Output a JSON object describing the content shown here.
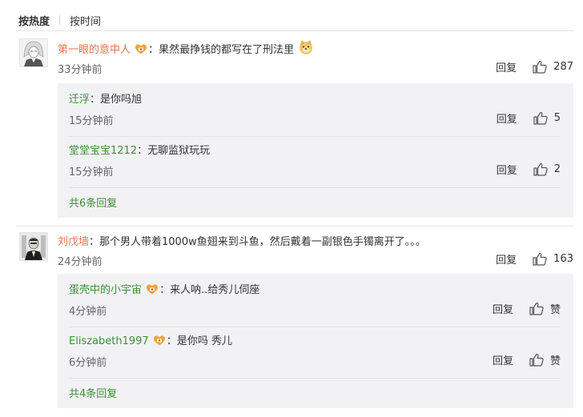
{
  "sort": {
    "active": "按热度",
    "other": "按时间"
  },
  "comments": [
    {
      "username": "第一眼的意中人",
      "text": "：果然最挣钱的都写在了刑法里",
      "time": "33分钟前",
      "reply_label": "回复",
      "likes": "287",
      "replies": [
        {
          "username": "迁浮",
          "text": "：是你吗旭",
          "time": "15分钟前",
          "reply_label": "回复",
          "likes": "5"
        },
        {
          "username": "堂堂宝宝1212",
          "text": "：无聊监狱玩玩",
          "time": "15分钟前",
          "reply_label": "回复",
          "likes": "2"
        }
      ],
      "more_replies": "共6条回复"
    },
    {
      "username": "刘戊墙",
      "text": "：那个男人带着1000w鱼翅来到斗鱼，然后戴着一副银色手镯离开了。。。",
      "time": "24分钟前",
      "reply_label": "回复",
      "likes": "163",
      "replies": [
        {
          "username": "蛋壳中的小宇宙",
          "text": "：来人呐..给秀儿伺座",
          "time": "4分钟前",
          "reply_label": "回复",
          "likes": "赞"
        },
        {
          "username": "Eliszabeth1997",
          "text": "：是你吗 秀儿",
          "time": "6分钟前",
          "reply_label": "回复",
          "likes": "赞"
        }
      ],
      "more_replies": "共4条回复"
    }
  ],
  "icons": {
    "like": "thumbs-up-icon",
    "vip": "vip-badge-icon",
    "emoji": "doge-emoji-icon"
  },
  "colors": {
    "username": "#eb7350",
    "reply_username": "#3f8f3a",
    "reply_bg": "#f2f2f5"
  }
}
